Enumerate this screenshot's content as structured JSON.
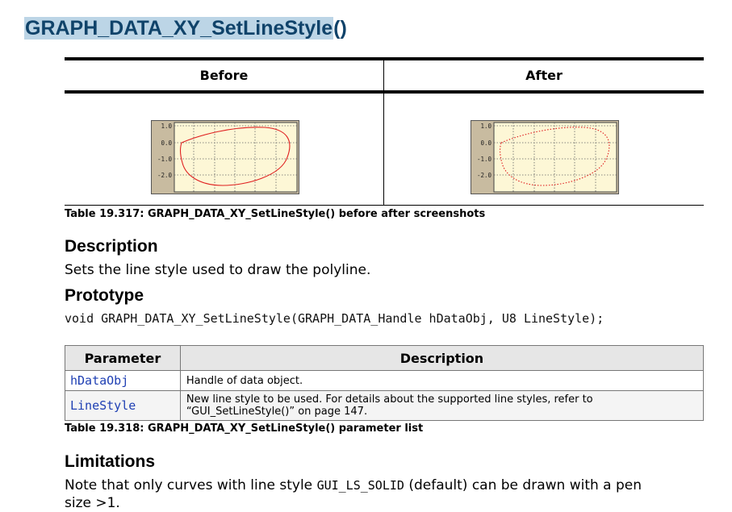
{
  "title": {
    "main": "GRAPH_DATA_XY_SetLineStyle",
    "parens": "()"
  },
  "screenshot_table": {
    "headers": [
      "Before",
      "After"
    ],
    "graph": {
      "y_ticks": [
        "1.0",
        "0.0",
        "-1.0",
        "-2.0"
      ],
      "before_line_style": "solid",
      "after_line_style": "dotted",
      "curve_color": "#e02020"
    },
    "caption": "Table 19.317: GRAPH_DATA_XY_SetLineStyle() before after screenshots"
  },
  "description": {
    "heading": "Description",
    "text": "Sets the line style used to draw the polyline."
  },
  "prototype": {
    "heading": "Prototype",
    "code": "void GRAPH_DATA_XY_SetLineStyle(GRAPH_DATA_Handle hDataObj, U8 LineStyle);"
  },
  "param_table": {
    "headers": [
      "Parameter",
      "Description"
    ],
    "rows": [
      {
        "name": "hDataObj",
        "desc_lines": [
          "Handle of data object."
        ]
      },
      {
        "name": "LineStyle",
        "desc_lines": [
          "New line style to be used. For details about the supported line styles, refer to",
          "“GUI_SetLineStyle()” on page 147."
        ]
      }
    ],
    "caption": "Table 19.318: GRAPH_DATA_XY_SetLineStyle() parameter list"
  },
  "limitations": {
    "heading": "Limitations",
    "text_before": "Note that only curves with line style ",
    "code": "GUI_LS_SOLID",
    "text_after": " (default) can be drawn with a pen",
    "line2": "size >1."
  }
}
